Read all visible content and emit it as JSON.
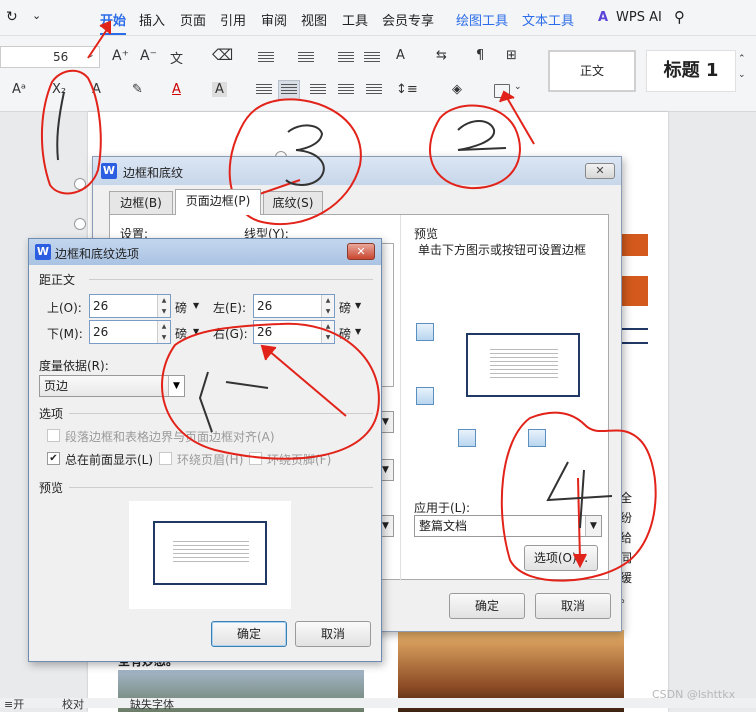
{
  "menu": {
    "items": [
      "开始",
      "插入",
      "页面",
      "引用",
      "审阅",
      "视图",
      "工具",
      "会员专享",
      "绘图工具",
      "文本工具",
      "WPS AI"
    ]
  },
  "ribbon": {
    "font_size": "56",
    "style_normal": "正文",
    "style_heading": "标题 1"
  },
  "border_dialog": {
    "title": "边框和底纹",
    "tabs": [
      "边框(B)",
      "页面边框(P)",
      "底纹(S)"
    ],
    "setting_label": "设置:",
    "line_type_label": "线型(Y):",
    "preview_label": "预览",
    "preview_hint": "单击下方图示或按钮可设置边框",
    "apply_to_label": "应用于(L):",
    "apply_to_value": "整篇文档",
    "options_button": "选项(O)...",
    "ok": "确定",
    "cancel": "取消"
  },
  "options_dialog": {
    "title": "边框和底纹选项",
    "margin_section": "距正文",
    "top_label": "上(O):",
    "top_value": "26",
    "bottom_label": "下(M):",
    "bottom_value": "26",
    "left_label": "左(E):",
    "left_value": "26",
    "right_label": "右(G):",
    "right_value": "26",
    "unit": "磅",
    "measure_label": "度量依据(R):",
    "measure_value": "页边",
    "options_section": "选项",
    "opt1": "段落边框和表格边界与页面边框对齐(A)",
    "opt2": "总在前面显示(L)",
    "opt3": "环绕页眉(H)",
    "opt4": "环绕页脚(F)",
    "preview_label": "预览",
    "ok": "确定",
    "cancel": "取消"
  },
  "doc_text": {
    "side_chars": [
      "全",
      "纷",
      "给",
      "同",
      "缓",
      "。"
    ],
    "caption": "全有妙感。"
  },
  "annotations": [
    "1",
    "2",
    "3",
    "4"
  ],
  "watermark": "CSDN @lshttkx",
  "status": {
    "left": "≡开",
    "mid": "校对",
    "right": "缺失字体"
  }
}
